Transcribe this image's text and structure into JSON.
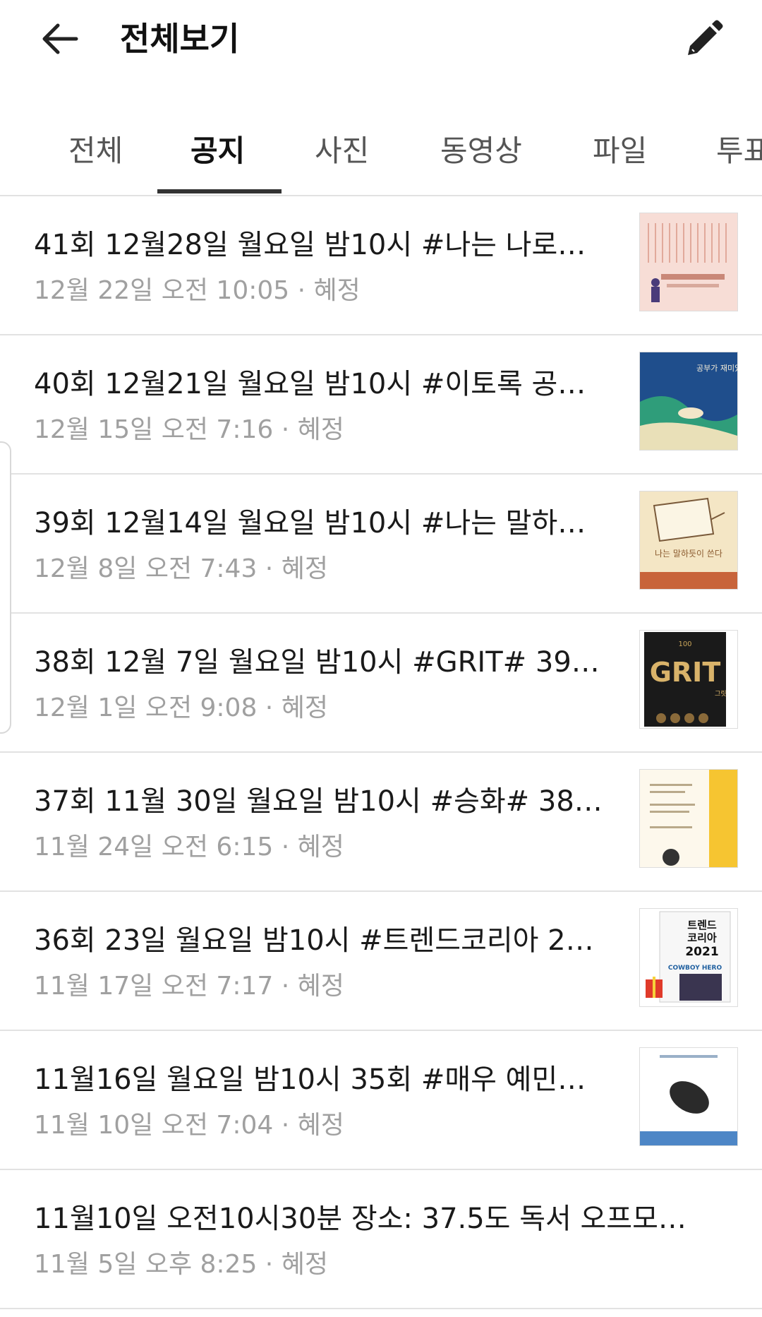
{
  "header": {
    "title": "전체보기",
    "back_icon": "arrow-left-icon",
    "edit_icon": "pencil-icon"
  },
  "tabs": [
    {
      "label": "전체",
      "active": false
    },
    {
      "label": "공지",
      "active": true
    },
    {
      "label": "사진",
      "active": false
    },
    {
      "label": "동영상",
      "active": false
    },
    {
      "label": "파일",
      "active": false
    },
    {
      "label": "투표",
      "active": false
    }
  ],
  "posts": [
    {
      "title": " 41회 12월28일 월요일 밤10시 #나는 나로…",
      "meta": "12월 22일 오전 10:05 · 혜정",
      "thumb": "book-cover-pink"
    },
    {
      "title": "40회 12월21일 월요일 밤10시 #이토록 공…",
      "meta": "12월 15일 오전 7:16 · 혜정",
      "thumb": "book-cover-blue-green"
    },
    {
      "title": "39회  12월14일 월요일 밤10시 #나는 말하…",
      "meta": "12월 8일 오전 7:43 · 혜정",
      "thumb": "book-cover-beige"
    },
    {
      "title": "38회  12월 7일 월요일 밤10시 #GRIT#  39…",
      "meta": "12월 1일 오전 9:08 · 혜정",
      "thumb": "book-cover-grit"
    },
    {
      "title": "37회 11월 30일 월요일 밤10시 #승화#  38…",
      "meta": "11월 24일 오전 6:15 · 혜정",
      "thumb": "book-cover-yellow"
    },
    {
      "title": "36회 23일 월요일 밤10시 #트렌드코리아 2…",
      "meta": "11월 17일 오전 7:17 · 혜정",
      "thumb": "book-cover-trend"
    },
    {
      "title": "11월16일 월요일 밤10시  35회 #매우 예민…",
      "meta": "11월 10일 오전 7:04 · 혜정",
      "thumb": "book-cover-hedgehog"
    },
    {
      "title": "11월10일 오전10시30분  장소:  37.5도  독서 오프모…",
      "meta": "11월 5일 오후 8:25 · 혜정",
      "thumb": ""
    }
  ],
  "cover_text": {
    "c2": "공부가 재미있어지는 순간",
    "c3": "나는 말하듯이 쓴다",
    "c4_top": "100",
    "c4_main": "GRIT",
    "c4_sub": "그릿",
    "c6_title1": "트렌드",
    "c6_title2": "코리아",
    "c6_year": "2021",
    "c6_tag": "COWBOY HERO"
  }
}
